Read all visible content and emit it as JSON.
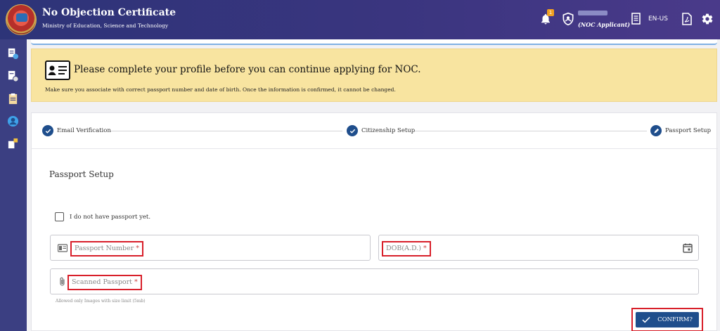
{
  "header": {
    "title": "No Objection Certificate",
    "subtitle": "Ministry of Education, Science and Technology",
    "notification_count": "1",
    "user_id": "9841234455",
    "user_role": "(NOC Applicant)",
    "language": "EN-US"
  },
  "notice": {
    "heading": "Please complete your profile before you can continue applying for NOC.",
    "text": "Make sure you associate with correct passport number and date of birth. Once the information is confirmed, it cannot be changed."
  },
  "steps": [
    {
      "label": "Email Verification",
      "state": "done"
    },
    {
      "label": "Citizenship Setup",
      "state": "done"
    },
    {
      "label": "Passport Setup",
      "state": "active"
    }
  ],
  "form": {
    "section_title": "Passport Setup",
    "no_passport_label": "I do not have passport yet.",
    "passport_number_placeholder": "Passport Number",
    "dob_placeholder": "DOB(A.D.)",
    "scanned_passport_placeholder": "Scanned Passport",
    "required_mark": "*",
    "upload_hint": "Allowed only Images with size limit (5mb)",
    "confirm_label": "CONFIRM?"
  },
  "colors": {
    "header_bg": "#2d3478",
    "sidebar_bg": "#3b3f82",
    "notice_bg": "#f8e4a0",
    "primary": "#1f4e8c",
    "highlight_red": "#d81f2a"
  },
  "icons": {
    "sidebar": [
      "document-add-icon",
      "document-settings-icon",
      "clipboard-icon",
      "user-circle-icon",
      "badge-icon"
    ]
  }
}
